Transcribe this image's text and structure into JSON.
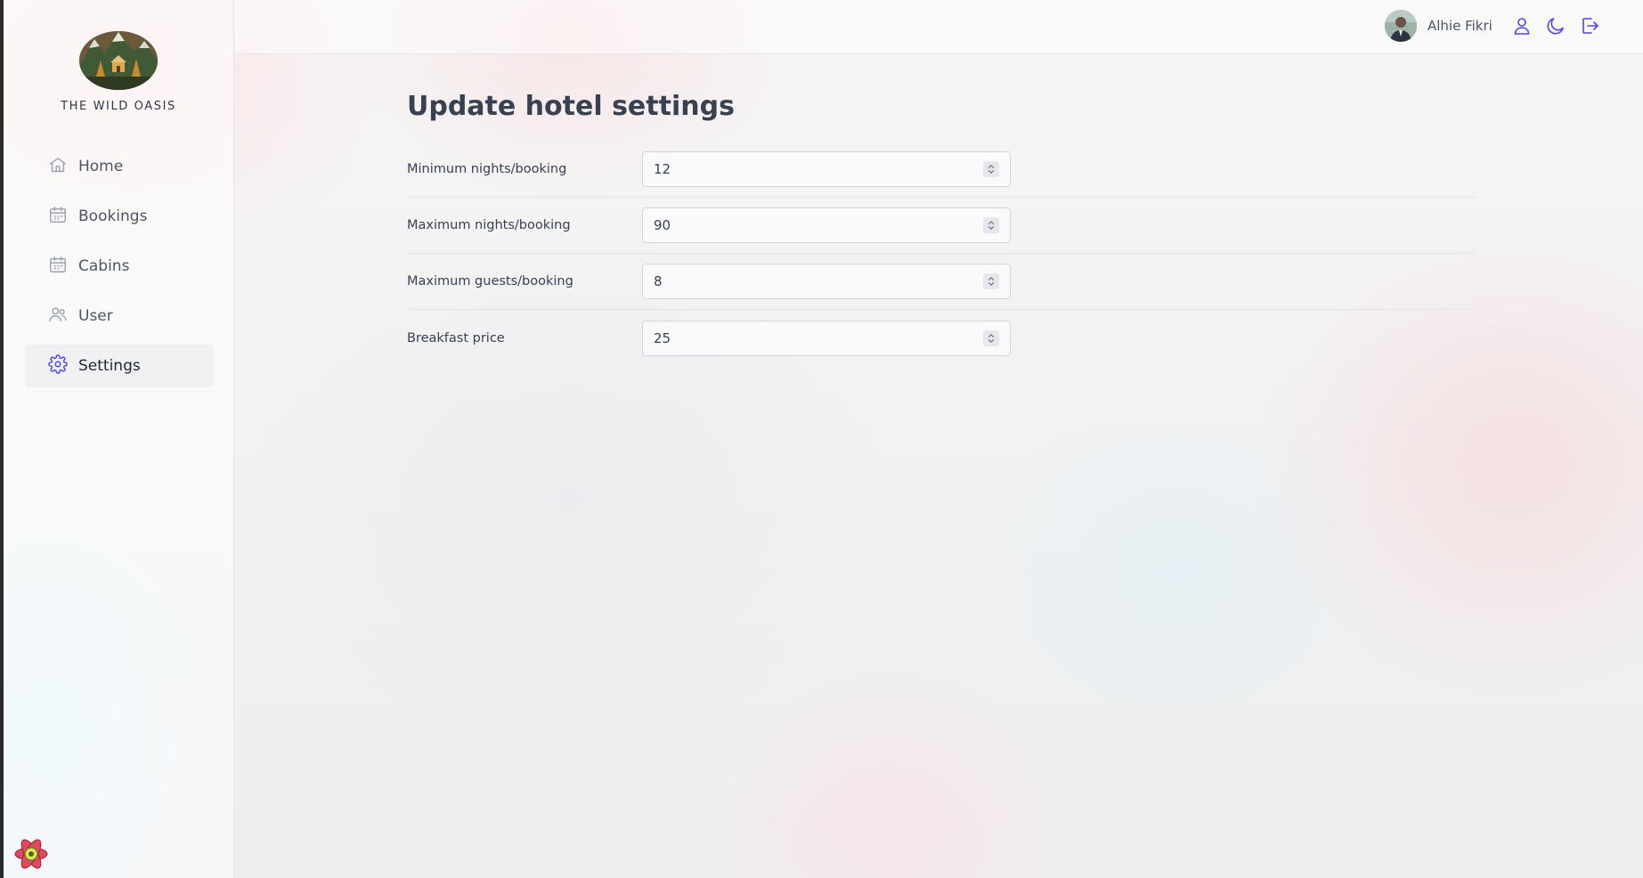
{
  "sidebar": {
    "brand": "THE WILD OASIS",
    "items": [
      {
        "label": "Home",
        "icon": "home-icon"
      },
      {
        "label": "Bookings",
        "icon": "calendar-icon"
      },
      {
        "label": "Cabins",
        "icon": "calendar-icon"
      },
      {
        "label": "User",
        "icon": "users-icon"
      },
      {
        "label": "Settings",
        "icon": "gear-icon",
        "active": true
      }
    ]
  },
  "header": {
    "user_name": "Alhie Fikri",
    "icons": [
      "user-icon",
      "moon-icon",
      "logout-icon"
    ]
  },
  "main": {
    "title": "Update hotel settings",
    "fields": [
      {
        "label": "Minimum nights/booking",
        "value": "12"
      },
      {
        "label": "Maximum nights/booking",
        "value": "90"
      },
      {
        "label": "Maximum guests/booking",
        "value": "8"
      },
      {
        "label": "Breakfast price",
        "value": "25"
      }
    ]
  },
  "colors": {
    "accent": "#4f46e5",
    "text": "#374151",
    "active_bg": "#eeeef1"
  }
}
